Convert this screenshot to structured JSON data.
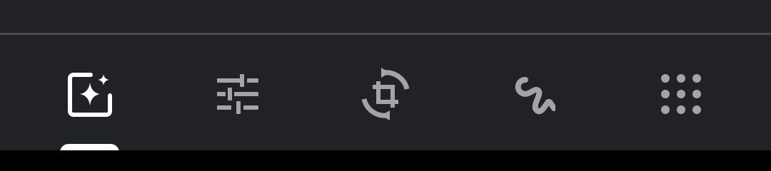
{
  "colors": {
    "background": "#212226",
    "divider": "#4a4b50",
    "active_icon": "#ffffff",
    "inactive_icon": "#a3a4a8",
    "active_indicator": "#ffffff",
    "nav_strip": "#000000"
  },
  "toolbar": {
    "selected": "suggestions",
    "tools": [
      {
        "id": "suggestions",
        "icon": "auto-enhance-sparkle-icon",
        "active": true
      },
      {
        "id": "adjust",
        "icon": "sliders-icon",
        "active": false
      },
      {
        "id": "crop",
        "icon": "crop-rotate-icon",
        "active": false
      },
      {
        "id": "markup",
        "icon": "markup-squiggle-icon",
        "active": false
      },
      {
        "id": "more",
        "icon": "apps-grid-icon",
        "active": false
      }
    ]
  }
}
